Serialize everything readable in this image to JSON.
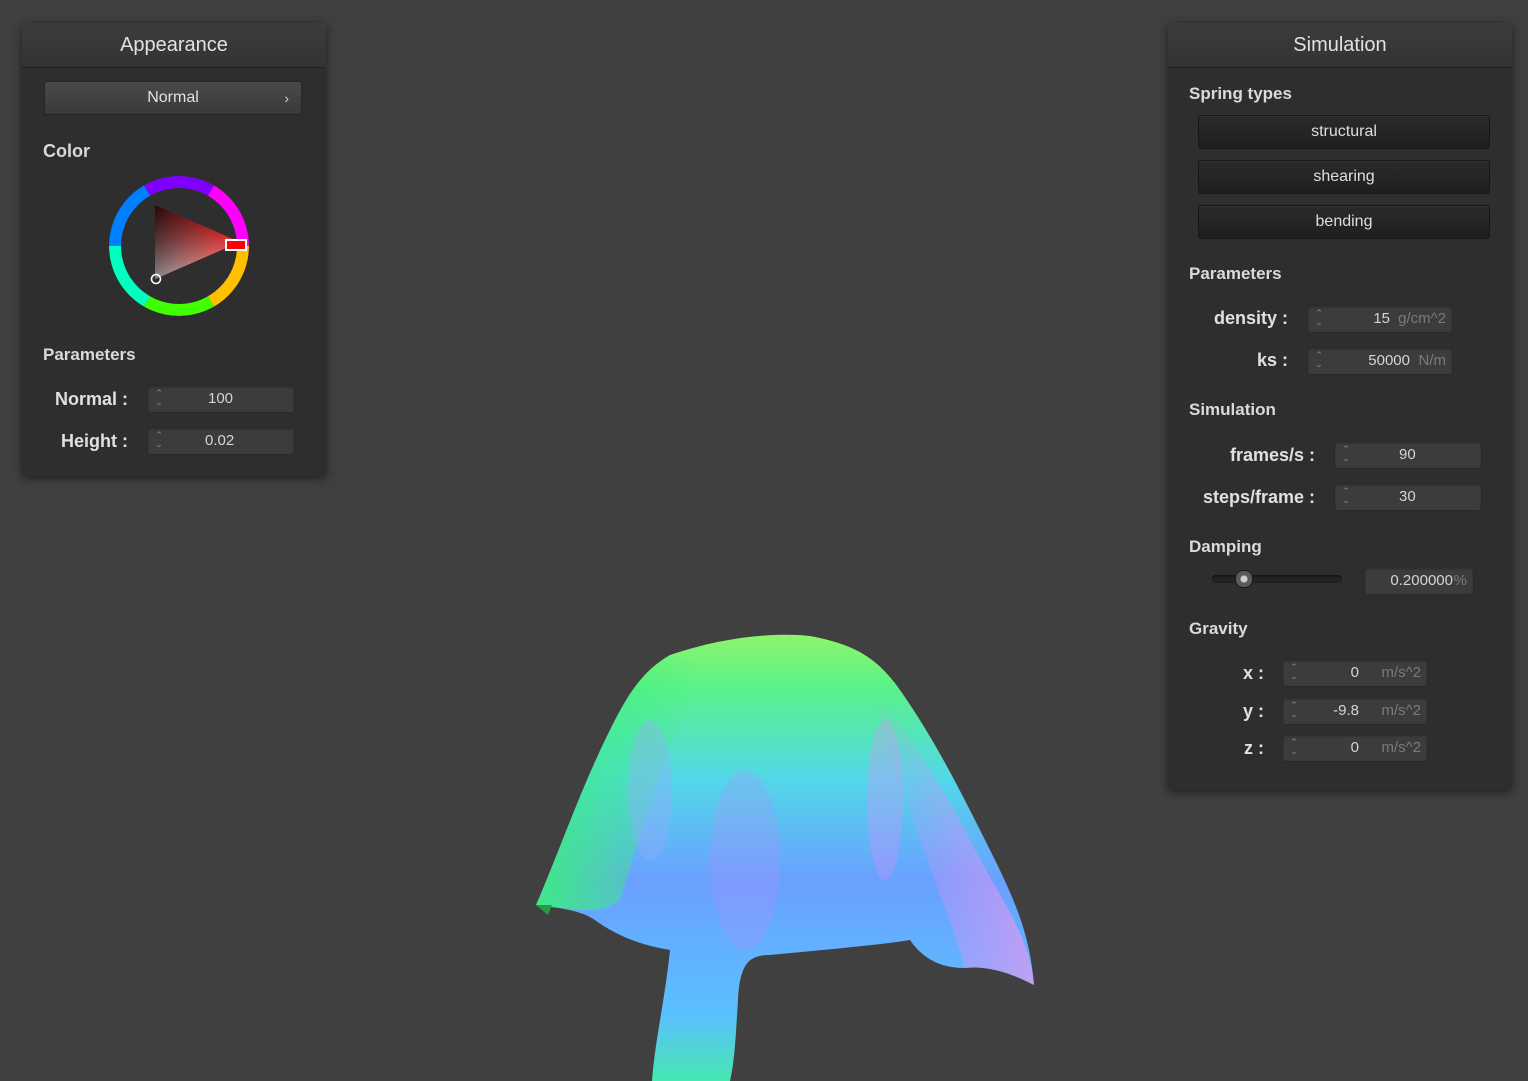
{
  "appearance": {
    "title": "Appearance",
    "shader_select": "Normal",
    "color_label": "Color",
    "color_value": "#ff0000",
    "parameters_label": "Parameters",
    "fields": [
      {
        "label": "Normal :",
        "value": "100"
      },
      {
        "label": "Height :",
        "value": "0.02"
      }
    ]
  },
  "simulation": {
    "title": "Simulation",
    "spring_types_label": "Spring types",
    "spring_types": [
      "structural",
      "shearing",
      "bending"
    ],
    "parameters_label": "Parameters",
    "density": {
      "label": "density :",
      "value": "15",
      "unit": "g/cm^2"
    },
    "ks": {
      "label": "ks :",
      "value": "50000",
      "unit": "N/m"
    },
    "simulation_label": "Simulation",
    "fps": {
      "label": "frames/s :",
      "value": "90"
    },
    "steps": {
      "label": "steps/frame :",
      "value": "30"
    },
    "damping_label": "Damping",
    "damping": {
      "value": "0.200000",
      "unit": "%",
      "slider_fraction": 0.2
    },
    "gravity_label": "Gravity",
    "gravity": [
      {
        "label": "x :",
        "value": "0",
        "unit": "m/s^2"
      },
      {
        "label": "y :",
        "value": "-9.8",
        "unit": "m/s^2"
      },
      {
        "label": "z :",
        "value": "0",
        "unit": "m/s^2"
      }
    ]
  }
}
